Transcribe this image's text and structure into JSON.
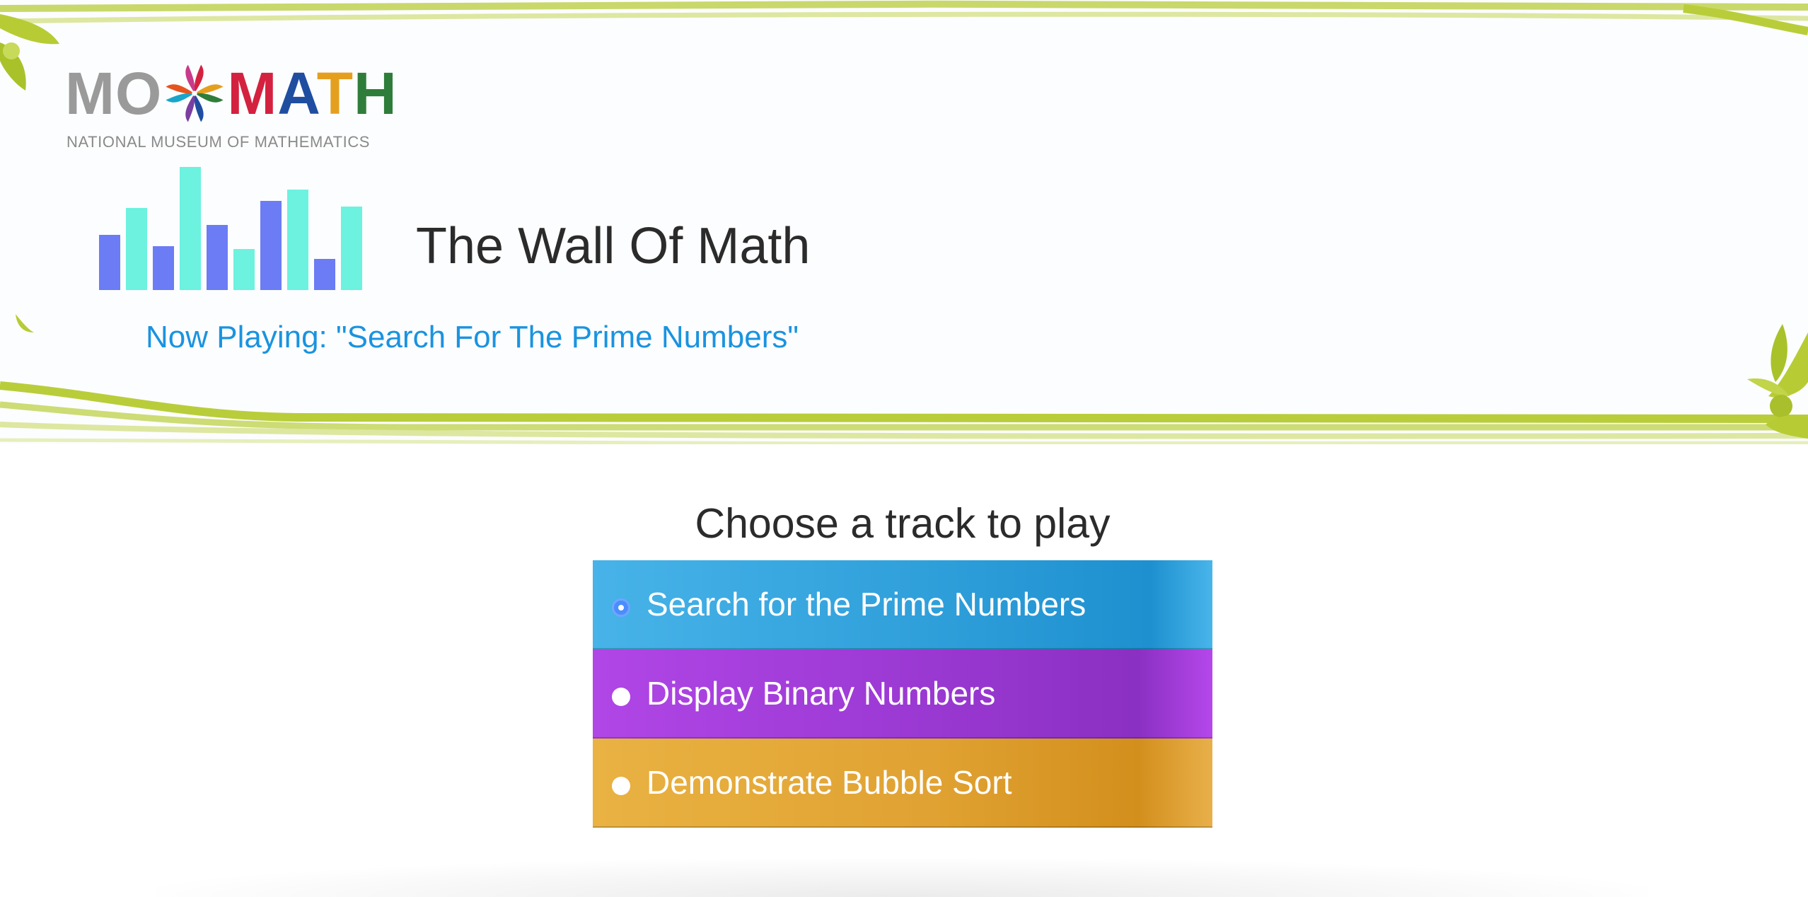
{
  "branding": {
    "logo_mo": "MO",
    "logo_math_letters": [
      "M",
      "A",
      "T",
      "H"
    ],
    "logo_subtitle": "NATIONAL MUSEUM OF MATHEMATICS",
    "logo_colors": {
      "mo": "#9a9a9a",
      "m": "#d4213f",
      "a": "#1f4ea1",
      "t": "#e59f1f",
      "h": "#2f7d3a"
    }
  },
  "header": {
    "title": "The Wall Of Math",
    "now_playing": "Now Playing: \"Search For The Prime Numbers\""
  },
  "chooser": {
    "heading": "Choose a track to play",
    "tracks": [
      {
        "label": "Search for the Prime Numbers",
        "selected": true,
        "color": "#2f9fda"
      },
      {
        "label": "Display Binary Numbers",
        "selected": false,
        "color": "#9a38d2"
      },
      {
        "label": "Demonstrate Bubble Sort",
        "selected": false,
        "color": "#e0a232"
      }
    ]
  },
  "icons": {
    "equalizer": "equalizer-bars-icon",
    "logo_swirl": "pinwheel-swirl-icon",
    "leaf_left": "leaf-decoration-icon",
    "leaf_right": "leaf-decoration-icon"
  },
  "colors": {
    "accent_blue": "#1a93e0",
    "leaf_green": "#b8cc3a",
    "eq_blue": "#6b7cf5",
    "eq_teal": "#6cf2df"
  }
}
